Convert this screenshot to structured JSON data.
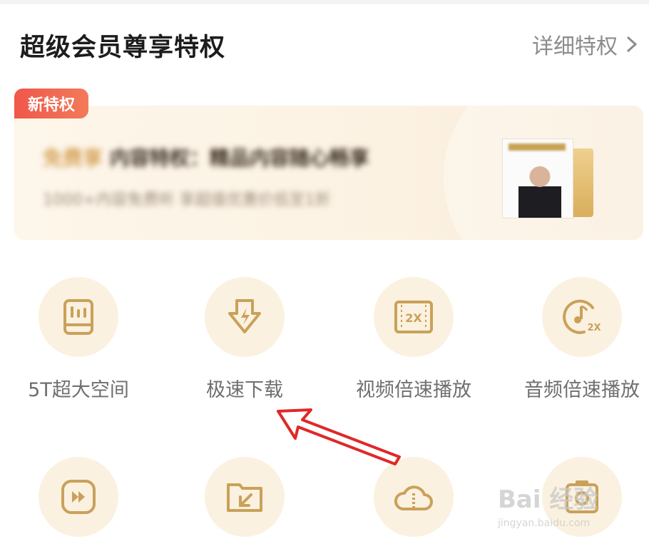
{
  "header": {
    "title": "超级会员尊享特权",
    "more_label": "详细特权"
  },
  "banner": {
    "badge": "新特权",
    "line1_accent": "免费享",
    "line1_text": "内容特权：精品内容随心畅享",
    "line2_text": "1000+内容免费听 享超值优惠价低至1折"
  },
  "features": [
    {
      "label": "5T超大空间",
      "icon": "storage-icon"
    },
    {
      "label": "极速下载",
      "icon": "fast-download-icon"
    },
    {
      "label": "视频倍速播放",
      "icon": "video-speed-2x-icon"
    },
    {
      "label": "音频倍速播放",
      "icon": "audio-speed-2x-icon"
    },
    {
      "label": "",
      "icon": "fast-forward-icon"
    },
    {
      "label": "",
      "icon": "folder-import-icon"
    },
    {
      "label": "",
      "icon": "cloud-zip-icon"
    },
    {
      "label": "",
      "icon": "photo-backup-icon"
    }
  ],
  "watermark": {
    "logo": "Bai 经验",
    "url": "jingyan.baidu.com"
  },
  "colors": {
    "icon_gold": "#c9a15a",
    "circle_bg": "#fbf1e0",
    "badge_red": "#f0574a",
    "arrow_red": "#e02828"
  }
}
